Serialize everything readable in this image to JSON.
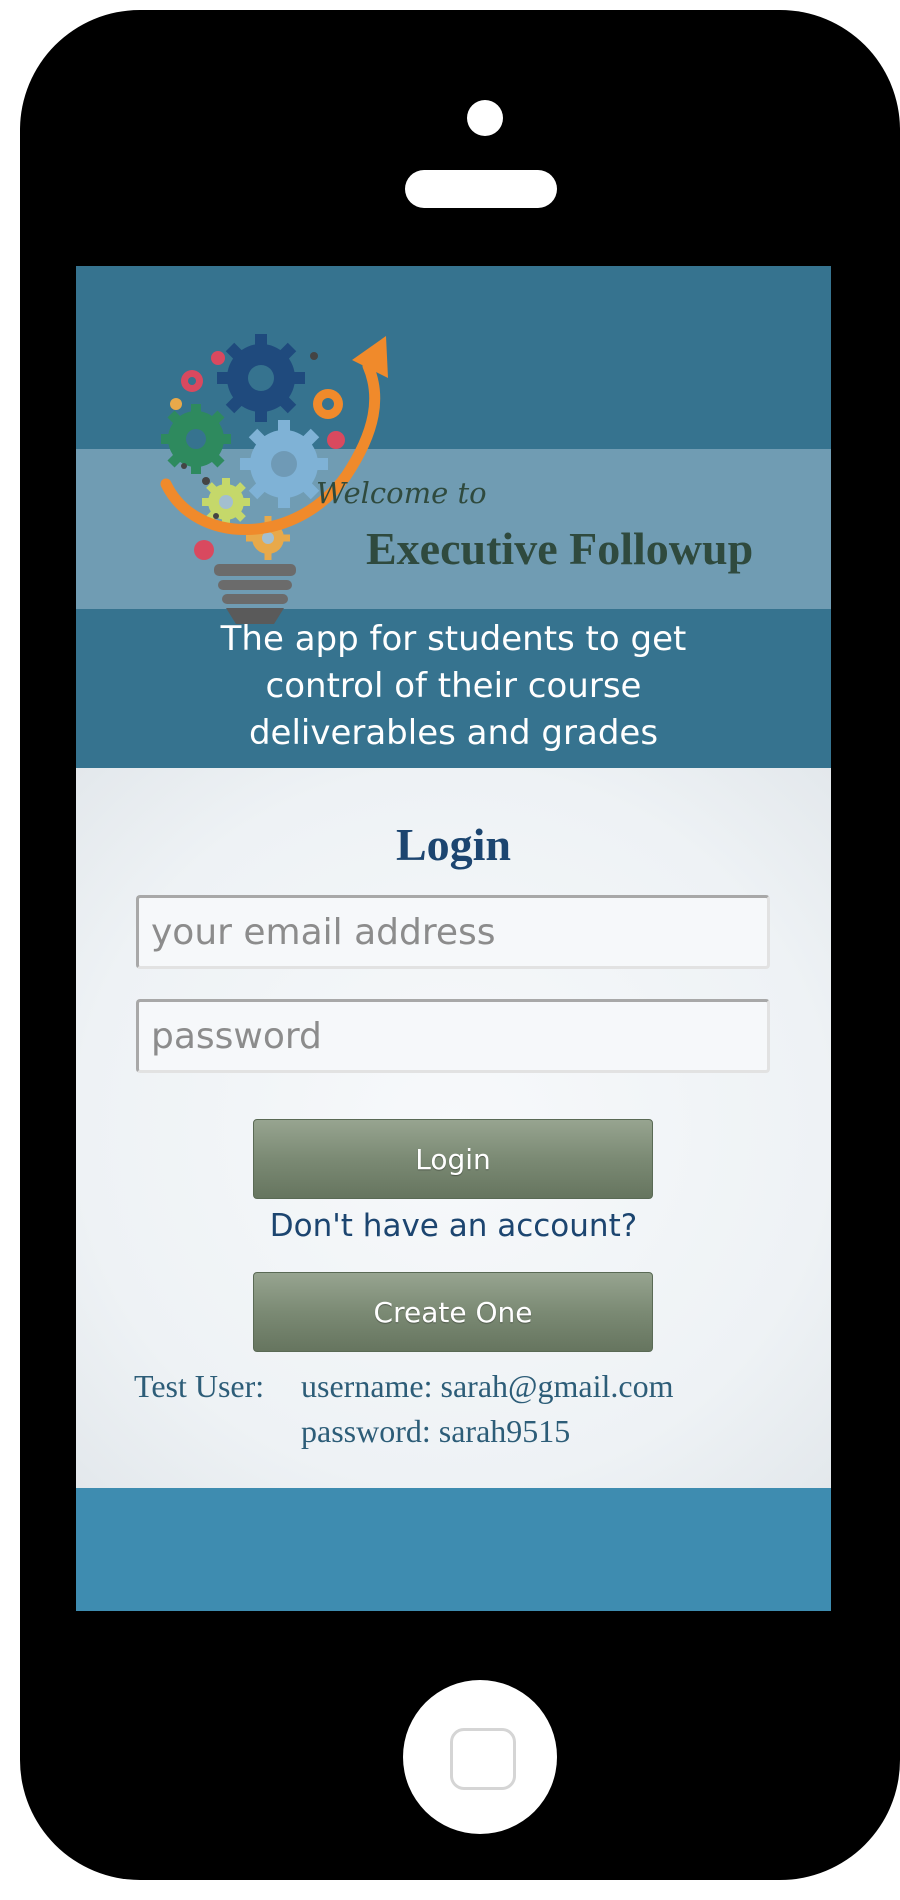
{
  "header": {
    "welcome": "Welcome to",
    "app_name": "Executive Followup",
    "tagline": [
      "The app for students to get",
      "control of their course",
      "deliverables and grades"
    ]
  },
  "login": {
    "title": "Login",
    "email_placeholder": "your email address",
    "email_value": "",
    "password_placeholder": "password",
    "password_value": "",
    "login_button": "Login",
    "no_account_text": "Don't have an account?",
    "create_button": "Create One"
  },
  "test_user": {
    "label": "Test User:",
    "username_line": "username: sarah@gmail.com",
    "password_line": "password: sarah9515"
  },
  "colors": {
    "header_bg": "#36738f",
    "button_green": "#7b8a74",
    "title_blue": "#1c4570",
    "footer_bg": "#3e8cb0"
  },
  "icons": {
    "logo": "lightbulb-gears-logo-icon"
  }
}
